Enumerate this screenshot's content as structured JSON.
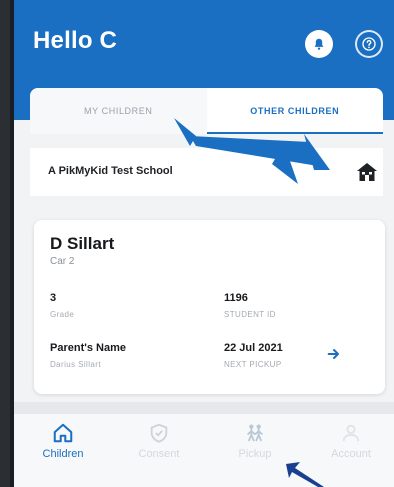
{
  "header": {
    "title": "Hello C",
    "bell_icon": "bell-icon",
    "help_icon": "help-circle-icon",
    "color": "#1b6fc2"
  },
  "tabs": [
    {
      "label": "MY CHILDREN",
      "active": false
    },
    {
      "label": "OTHER CHILDREN",
      "active": true
    }
  ],
  "school": {
    "name": "A PikMyKid Test School",
    "icon": "school-house-icon"
  },
  "child": {
    "name": "D Sillart",
    "car": "Car 2",
    "grade_value": "3",
    "grade_label": "Grade",
    "student_id_value": "1196",
    "student_id_label": "STUDENT ID",
    "parent_value": "Parent's Name",
    "parent_label": "Darius Sillart",
    "next_pickup_value": "22 Jul 2021",
    "next_pickup_label": "NEXT PICKUP"
  },
  "nav": [
    {
      "label": "Children",
      "icon": "home-icon",
      "active": true
    },
    {
      "label": "Consent",
      "icon": "shield-check-icon",
      "active": false
    },
    {
      "label": "Pickup",
      "icon": "people-icon",
      "active": false
    },
    {
      "label": "Account",
      "icon": "person-icon",
      "active": false
    }
  ]
}
